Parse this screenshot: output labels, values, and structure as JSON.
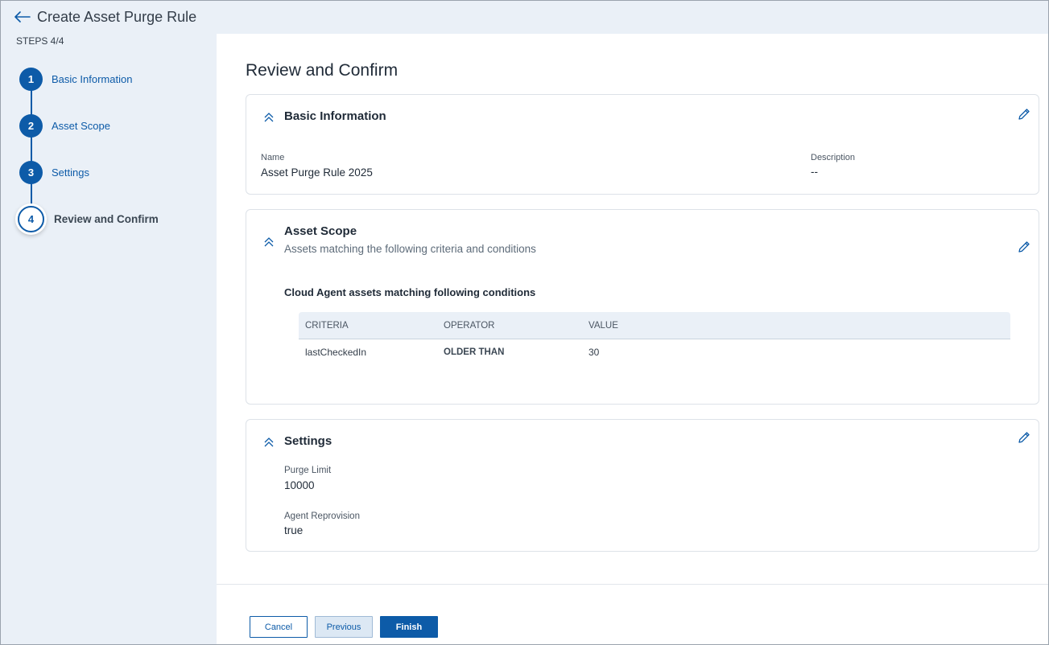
{
  "header": {
    "title": "Create Asset Purge Rule",
    "back_icon": "arrow-left-icon"
  },
  "sidebar": {
    "steps_label": "STEPS 4/4",
    "steps": [
      {
        "number": "1",
        "label": "Basic Information"
      },
      {
        "number": "2",
        "label": "Asset Scope"
      },
      {
        "number": "3",
        "label": "Settings"
      },
      {
        "number": "4",
        "label": "Review and Confirm"
      }
    ],
    "current_step": 4
  },
  "main": {
    "title": "Review and Confirm",
    "basic_info": {
      "title": "Basic Information",
      "name_label": "Name",
      "name_value": "Asset Purge Rule 2025",
      "description_label": "Description",
      "description_value": "--"
    },
    "asset_scope": {
      "title": "Asset Scope",
      "subtitle": "Assets matching the following criteria and conditions",
      "conditions_heading": "Cloud Agent assets matching following conditions",
      "columns": [
        "CRITERIA",
        "OPERATOR",
        "VALUE"
      ],
      "rows": [
        {
          "criteria": "lastCheckedIn",
          "operator": "OLDER THAN",
          "value": "30"
        }
      ]
    },
    "settings": {
      "title": "Settings",
      "purge_limit_label": "Purge Limit",
      "purge_limit_value": "10000",
      "agent_reprovision_label": "Agent Reprovision",
      "agent_reprovision_value": "true"
    }
  },
  "footer": {
    "cancel_label": "Cancel",
    "previous_label": "Previous",
    "finish_label": "Finish"
  },
  "colors": {
    "accent": "#0d5ba8",
    "sidebar_bg": "#eaf0f7",
    "panel_bg": "#ffffff"
  }
}
